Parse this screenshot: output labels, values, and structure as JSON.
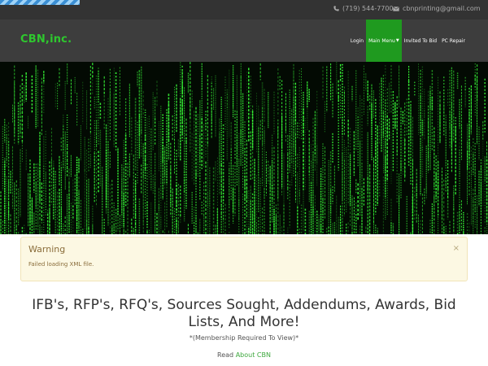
{
  "topbar": {
    "phone": "(719) 544-7700",
    "email": "cbnprinting@gmail.com",
    "phone_icon": "phone-icon",
    "email_icon": "envelope-icon"
  },
  "navbar": {
    "brand": "CBN,inc.",
    "items": [
      {
        "label": "Login"
      },
      {
        "label": "Main Menu",
        "active": true,
        "has_dropdown": true
      },
      {
        "label": "Invited To Bid"
      },
      {
        "label": "PC Repair"
      }
    ]
  },
  "warning": {
    "title": "Warning",
    "message": "Failed loading XML file.",
    "close": "×"
  },
  "content": {
    "headline": "IFB's, RFP's, RFQ's, Sources Sought, Addendums, Awards, Bid Lists, And More!",
    "subline": "*(Membership Required To View)*",
    "read_prefix": "Read",
    "read_link": "About CBN"
  },
  "colors": {
    "brand": "#2ec82e",
    "nav_active": "#1f9a1f",
    "matrix_green": "#39ff39",
    "warning_bg": "#fcf8e3",
    "warning_text": "#8a6d3b"
  }
}
